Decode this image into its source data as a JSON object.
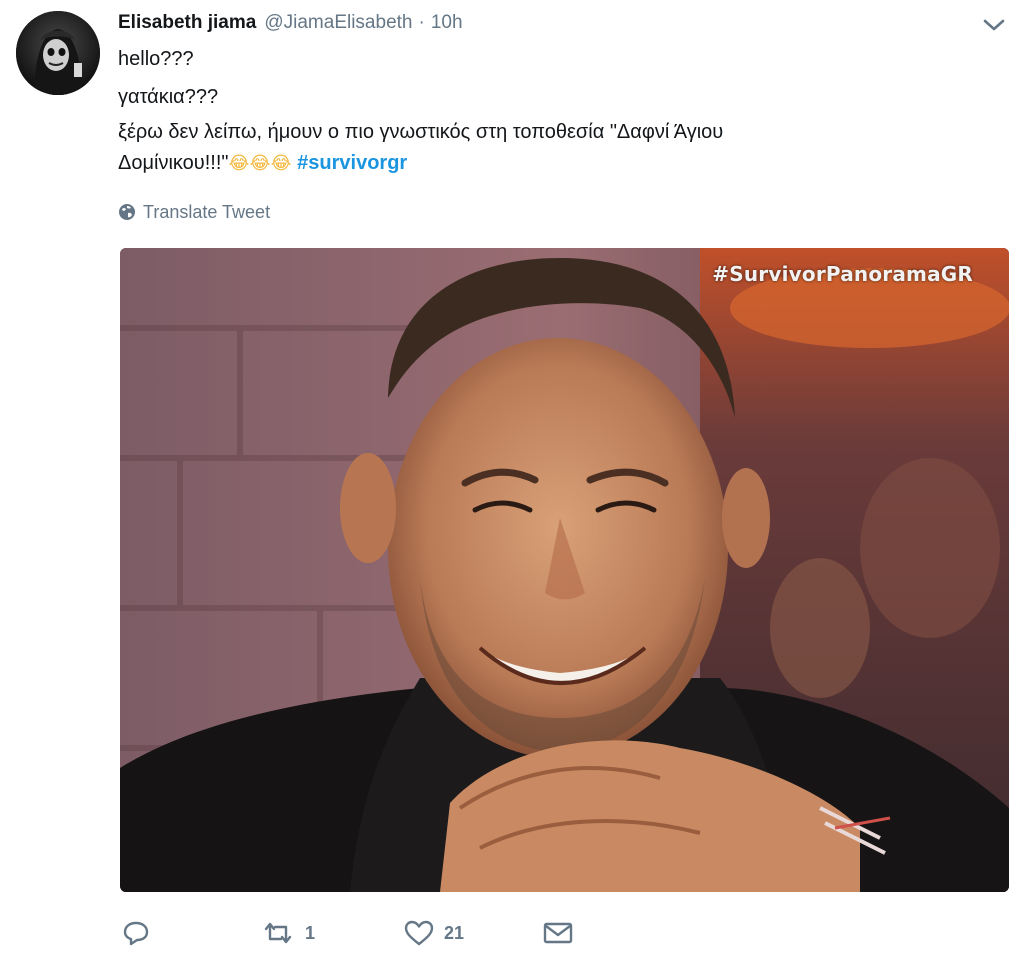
{
  "tweet": {
    "author_name": "Elisabeth jiama",
    "author_handle": "@JiamaElisabeth",
    "separator": "·",
    "time": "10h",
    "lines": {
      "line1": "hello???",
      "line2": "γατάκια???",
      "line3": "ξέρω δεν λείπω, ήμουν ο πιο γνωστικός στη τοποθεσία \"Δαφνί Άγιου",
      "line4_text": "Δομίνικου!!!\"",
      "line4_emoji": "😂😂😂",
      "hashtag": "#survivorgr"
    },
    "translate_label": "Translate Tweet",
    "media_watermark": "#SurvivorPanoramaGR"
  },
  "actions": {
    "reply_count": "",
    "retweet_count": "1",
    "like_count": "21"
  },
  "icons": {
    "menu": "chevron-down-icon",
    "translate": "globe-icon",
    "reply": "reply-icon",
    "retweet": "retweet-icon",
    "like": "heart-icon",
    "dm": "envelope-icon"
  },
  "colors": {
    "text": "#14171a",
    "secondary": "#657786",
    "link": "#1b95e0"
  }
}
